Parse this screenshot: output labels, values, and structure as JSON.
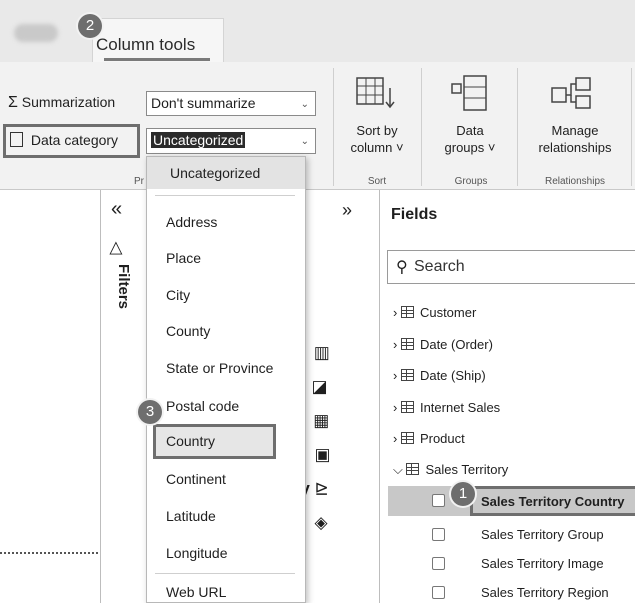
{
  "tabs": {
    "active_label": "Column tools"
  },
  "badges": {
    "b1": "1",
    "b2": "2",
    "b3": "3"
  },
  "ribbon": {
    "summarization_label": "Summarization",
    "summarization_value": "Don't summarize",
    "data_category_label": "Data category",
    "data_category_value": "Uncategorized",
    "properties_group_partial": "Pr",
    "sort_by_line1": "Sort by",
    "sort_by_line2": "column ˅",
    "sort_group": "Sort",
    "data_groups_line1": "Data",
    "data_groups_line2": "groups ˅",
    "groups_group": "Groups",
    "manage_line1": "Manage",
    "manage_line2": "relationships",
    "relationships_group": "Relationships"
  },
  "dropdown": {
    "selected_header": "Uncategorized",
    "options": [
      "Address",
      "Place",
      "City",
      "County",
      "State or Province",
      "Postal code",
      "Country",
      "Continent",
      "Latitude",
      "Longitude",
      "Web URL"
    ],
    "highlighted": "Country"
  },
  "filters": {
    "label": "Filters",
    "collapse_glyph": "«"
  },
  "visualizations": {
    "expand_glyph": "»",
    "py_label": "Py"
  },
  "fields": {
    "title": "Fields",
    "search_placeholder": "Search",
    "tables": [
      "Customer",
      "Date (Order)",
      "Date (Ship)",
      "Internet Sales",
      "Product",
      "Sales Territory"
    ],
    "expanded_table": "Sales Territory",
    "columns": [
      "Sales Territory Country",
      "Sales Territory Group",
      "Sales Territory Image",
      "Sales Territory Region"
    ],
    "selected_column": "Sales Territory Country"
  },
  "colors": {
    "highlight_border": "#6e6e6e",
    "selected_row": "#c8c8c8",
    "ribbon_bg": "#f2f2f2"
  }
}
